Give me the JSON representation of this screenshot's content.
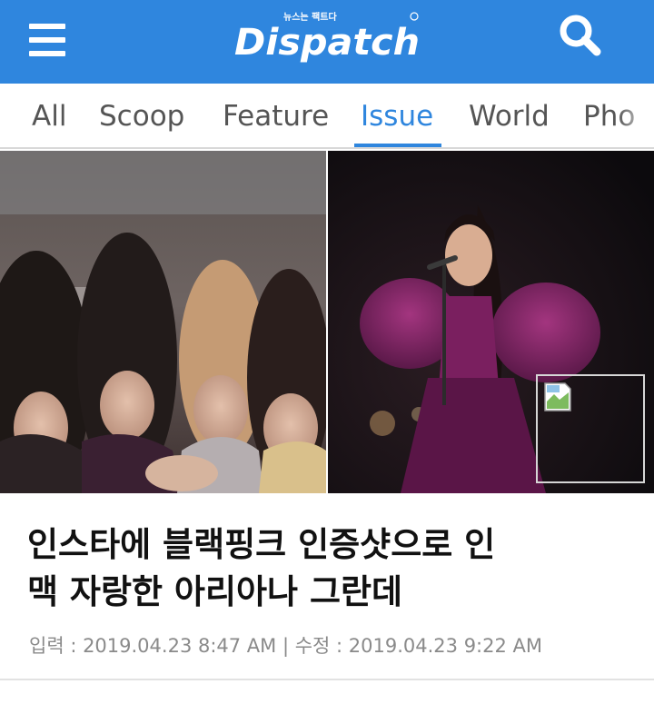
{
  "header": {
    "brand": "Dispatch",
    "tagline": "뉴스는 팩트다",
    "icons": [
      "hamburger-menu-icon",
      "search-icon"
    ],
    "color": "#2f86de"
  },
  "tabs": [
    {
      "label": "All",
      "active": false
    },
    {
      "label": "Scoop",
      "active": false
    },
    {
      "label": "Feature",
      "active": false
    },
    {
      "label": "Issue",
      "active": true
    },
    {
      "label": "World",
      "active": false
    },
    {
      "label": "Pho",
      "active": false
    }
  ],
  "article": {
    "headline_line1": "인스타에 블랙핑크 인증샷으로 인",
    "headline_line2": "맥 자랑한 아리아나 그란데",
    "dateline": "입력 : 2019.04.23 8:47 AM | 수정 : 2019.04.23 9:22 AM"
  }
}
